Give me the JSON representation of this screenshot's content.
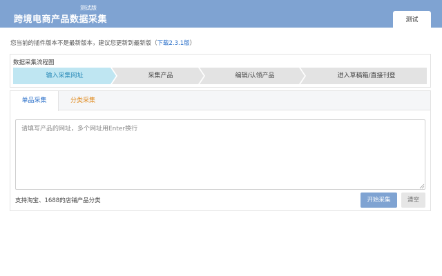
{
  "header": {
    "badge": "测试版",
    "title": "跨境电商产品数据采集",
    "tab_label": "测试",
    "background_color": "#7fa3d2"
  },
  "notice": {
    "text": "您当前的插件版本不是最新版本，建议您更新到最新版（",
    "link_text": "下载2.3.1版",
    "suffix": "）"
  },
  "flow": {
    "title": "数据采集流程图",
    "steps": [
      {
        "label": "输入采集网址",
        "active": true
      },
      {
        "label": "采集产品",
        "active": false
      },
      {
        "label": "编辑/认领产品",
        "active": false
      },
      {
        "label": "进入草稿箱/直接刊登",
        "active": false
      }
    ],
    "active_color": "#bfe6f2",
    "inactive_color": "#e3e3e3"
  },
  "tabs": [
    {
      "label": "单品采集",
      "active": true
    },
    {
      "label": "分类采集",
      "active": false
    }
  ],
  "input": {
    "placeholder": "请填写产品的网址，多个网址用Enter换行",
    "value": ""
  },
  "hint": "支持淘宝、1688的店铺产品分类",
  "buttons": {
    "start": "开始采集",
    "clear": "清空"
  }
}
